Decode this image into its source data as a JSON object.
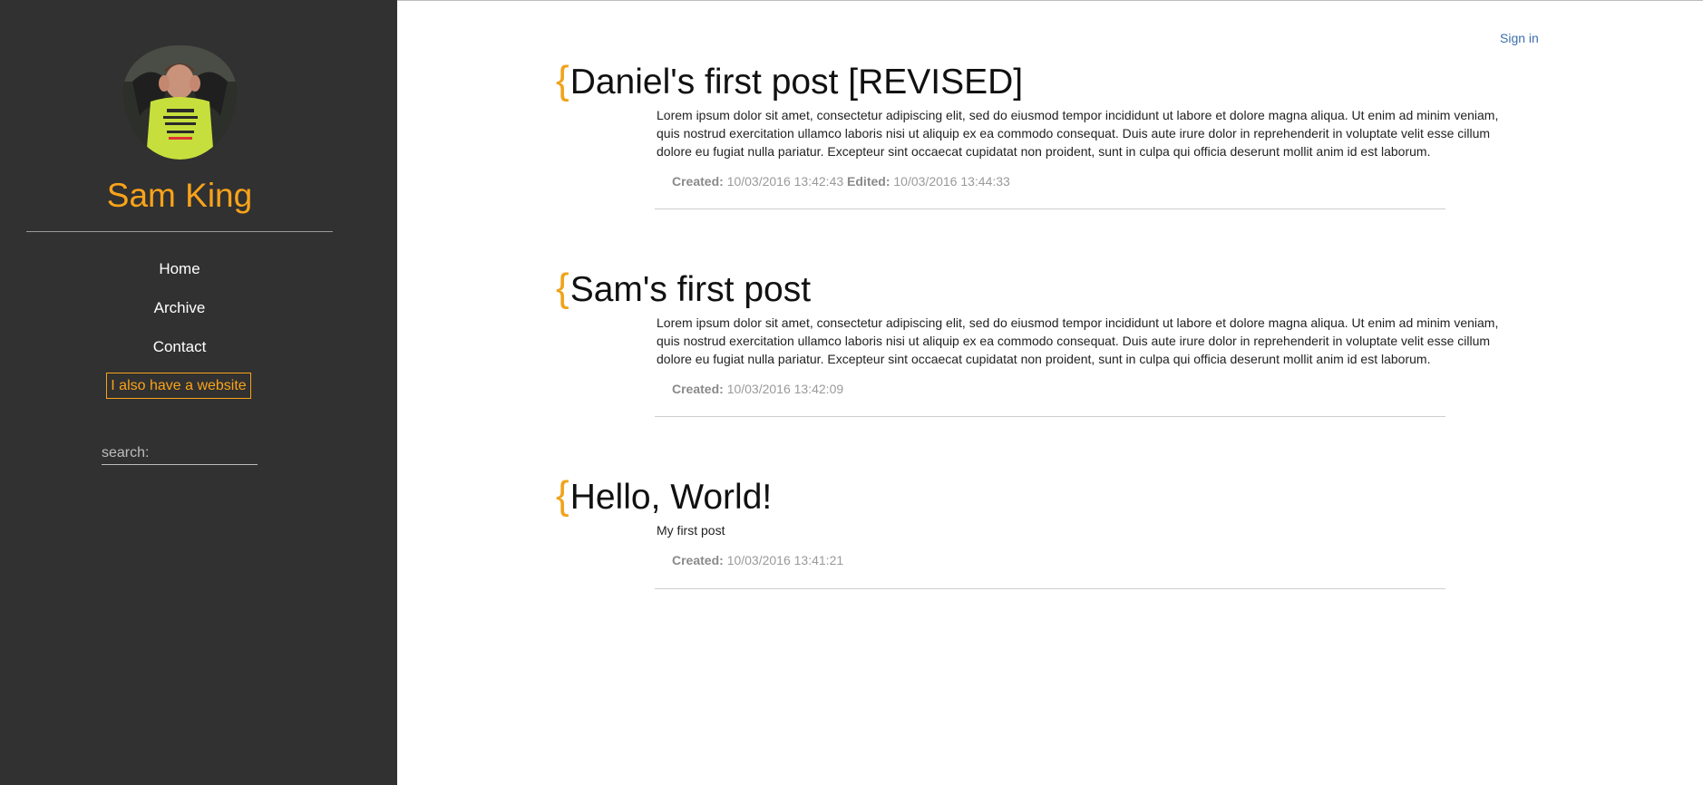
{
  "sidebar": {
    "author_name": "Sam King",
    "nav": [
      {
        "label": "Home"
      },
      {
        "label": "Archive"
      },
      {
        "label": "Contact"
      }
    ],
    "website_button": "I also have a website",
    "search_placeholder": "search:"
  },
  "header": {
    "sign_in": "Sign in"
  },
  "posts": [
    {
      "title": "Daniel's first post [REVISED]",
      "body": "Lorem ipsum dolor sit amet, consectetur adipiscing elit, sed do eiusmod tempor incididunt ut labore et dolore magna aliqua. Ut enim ad minim veniam, quis nostrud exercitation ullamco laboris nisi ut aliquip ex ea commodo consequat. Duis aute irure dolor in reprehenderit in voluptate velit esse cillum dolore eu fugiat nulla pariatur. Excepteur sint occaecat cupidatat non proident, sunt in culpa qui officia deserunt mollit anim id est laborum.",
      "created_label": "Created:",
      "created": "10/03/2016 13:42:43",
      "edited_label": "Edited:",
      "edited": "10/03/2016 13:44:33"
    },
    {
      "title": "Sam's first post",
      "body": "Lorem ipsum dolor sit amet, consectetur adipiscing elit, sed do eiusmod tempor incididunt ut labore et dolore magna aliqua. Ut enim ad minim veniam, quis nostrud exercitation ullamco laboris nisi ut aliquip ex ea commodo consequat. Duis aute irure dolor in reprehenderit in voluptate velit esse cillum dolore eu fugiat nulla pariatur. Excepteur sint occaecat cupidatat non proident, sunt in culpa qui officia deserunt mollit anim id est laborum.",
      "created_label": "Created:",
      "created": "10/03/2016 13:42:09"
    },
    {
      "title": "Hello, World!",
      "body": "My first post",
      "created_label": "Created:",
      "created": "10/03/2016 13:41:21"
    }
  ],
  "colors": {
    "sidebar_bg": "#313131",
    "accent": "#f9a31a",
    "link": "#3c6fae"
  },
  "icons": {
    "title_brace": "{"
  }
}
